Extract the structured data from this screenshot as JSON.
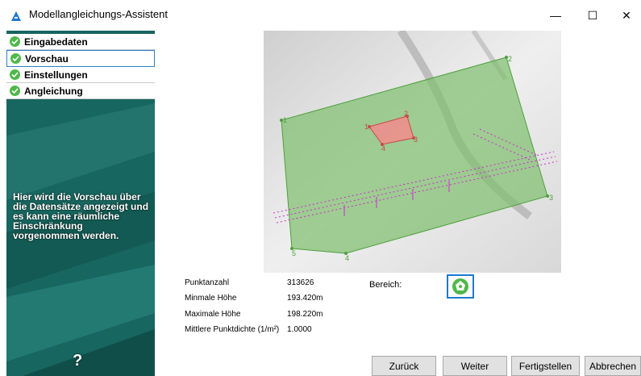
{
  "window": {
    "title": "Modellangleichungs-Assistent",
    "minimize": "—",
    "maximize": "☐",
    "close": "✕"
  },
  "sidebar": {
    "steps": [
      {
        "label": "Eingabedaten",
        "active": false
      },
      {
        "label": "Vorschau",
        "active": true
      },
      {
        "label": "Einstellungen",
        "active": false
      },
      {
        "label": "Angleichung",
        "active": false
      }
    ],
    "description": "Hier wird die Vorschau über die Datensätze angezeigt und es kann eine räumliche Einschränkung vorgenommen werden.",
    "help": "?"
  },
  "preview": {
    "green_polygon_labels": [
      "1",
      "2",
      "3",
      "4",
      "5"
    ],
    "red_polygon_labels": [
      "1",
      "2",
      "3",
      "4"
    ]
  },
  "stats": [
    {
      "label": "Punktanzahl",
      "value": "313626"
    },
    {
      "label": "Minmale Höhe",
      "value": "193.420m"
    },
    {
      "label": "Maximale Höhe",
      "value": "198.220m"
    },
    {
      "label": "Mittlere Punktdichte (1/m²)",
      "value": "1.0000"
    }
  ],
  "bereich": {
    "label": "Bereich:"
  },
  "buttons": {
    "back": "Zurück",
    "next": "Weiter",
    "finish": "Fertigstellen",
    "cancel": "Abbrechen"
  },
  "colors": {
    "sidebar": "#17665f",
    "check": "#4fb84a",
    "green_area": "#7fbf6f",
    "red_area": "#f28c8c",
    "points": "#d12ad1"
  }
}
